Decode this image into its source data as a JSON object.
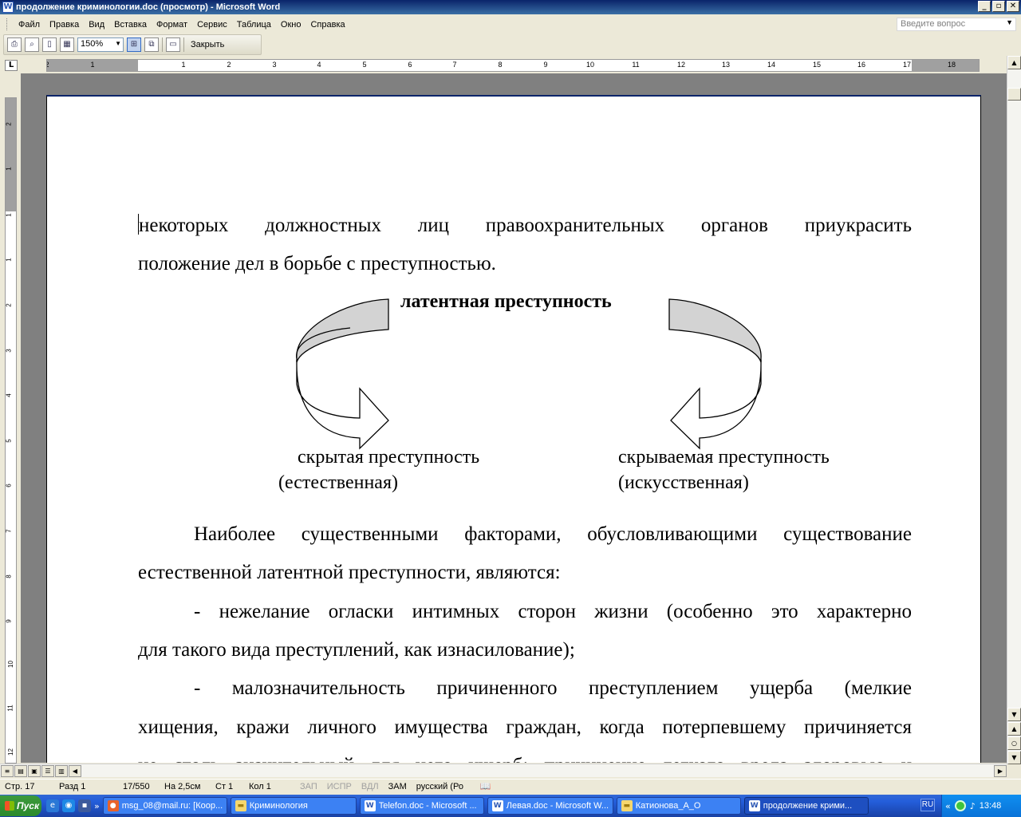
{
  "window": {
    "title": "продолжение криминологии.doc (просмотр) - Microsoft Word",
    "app_icon": "W",
    "minimize_label": "_",
    "maximize_label": "▫",
    "close_label": "✕"
  },
  "menu": {
    "items": [
      "Файл",
      "Правка",
      "Вид",
      "Вставка",
      "Формат",
      "Сервис",
      "Таблица",
      "Окно",
      "Справка"
    ],
    "help_placeholder": "Введите вопрос"
  },
  "toolbar": {
    "zoom": "150%",
    "close_label": "Закрыть"
  },
  "ruler": {
    "corner": "L",
    "h_numbers": [
      "2",
      "1",
      "1",
      "2",
      "3",
      "4",
      "5",
      "6",
      "7",
      "8",
      "9",
      "10",
      "11",
      "12",
      "13",
      "14",
      "15",
      "16",
      "17",
      "18"
    ],
    "v_numbers": [
      "2",
      "1",
      "1",
      "1",
      "2",
      "3",
      "4",
      "5",
      "6",
      "7",
      "8",
      "9",
      "10",
      "11",
      "12"
    ]
  },
  "document": {
    "para1": "некоторых должностных лиц правоохранительных органов приукрасить",
    "para1_cont": "положение дел в борьбе с преступностью.",
    "diagram": {
      "title": "латентная преступность",
      "left_line1": "скрытая преступность",
      "left_line2": "(естественная)",
      "right_line1": "скрываемая преступность",
      "right_line2": "(искусственная)"
    },
    "para2": "Наиболее существенными факторами, обусловливающими существование",
    "para2_cont": "естественной латентной преступности, являются:",
    "para3": "- нежелание огласки интимных сторон жизни (особенно это характерно",
    "para3_cont": "для такого вида преступлений, как изнасилование);",
    "para4": "- малозначительность причиненного преступлением ущерба (мелкие",
    "para4_cont": "хищения, кражи личного имущества граждан, когда потерпевшему причиняется",
    "para4_cont2": "не столь значительный для него ущерб; причинение легкого вреда здоровью и"
  },
  "status": {
    "page": "Стр. 17",
    "section": "Разд 1",
    "pages": "17/550",
    "at": "На 2,5см",
    "line": "Ст 1",
    "col": "Кол 1",
    "rec": "ЗАП",
    "trk": "ИСПР",
    "ext": "ВДЛ",
    "ovr": "ЗАМ",
    "lang": "русский (Ро"
  },
  "taskbar": {
    "start": "Пуск",
    "tasks": [
      "msg_08@mail.ru: [Коор...",
      "Криминология",
      "Telefon.doc - Microsoft ...",
      "Левая.doc - Microsoft W...",
      "Катионова_А_О",
      "продолжение крими..."
    ],
    "language": "RU",
    "clock": "13:48"
  },
  "colors": {
    "titlebar": "#0a246a",
    "taskbar": "#245edb",
    "start": "#2b8a2b",
    "arrow_fill": "#d3d3d3"
  }
}
